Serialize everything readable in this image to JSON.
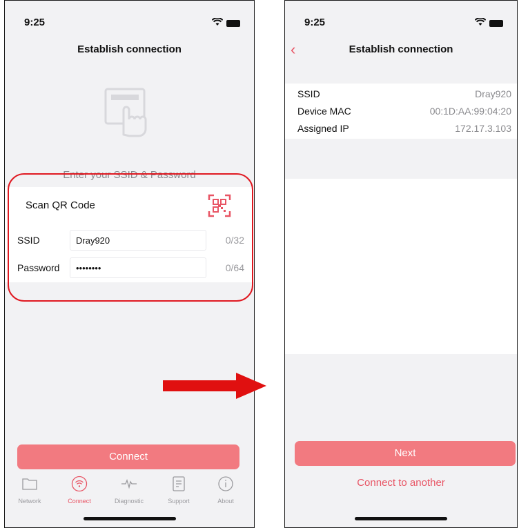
{
  "left": {
    "status_time": "9:25",
    "nav_title": "Establish connection",
    "enter_text": "Enter your SSID & Password",
    "scan_label": "Scan QR Code",
    "ssid_label": "SSID",
    "ssid_value": "Dray920",
    "ssid_count": "0/32",
    "password_label": "Password",
    "password_value": "••••••••",
    "password_count": "0/64",
    "connect_label": "Connect",
    "tabs": [
      {
        "label": "Network",
        "icon": "folder-icon"
      },
      {
        "label": "Connect",
        "icon": "wifi-icon"
      },
      {
        "label": "Diagnostic",
        "icon": "pulse-icon"
      },
      {
        "label": "Support",
        "icon": "document-icon"
      },
      {
        "label": "About",
        "icon": "info-icon"
      }
    ],
    "active_tab": "Connect"
  },
  "right": {
    "status_time": "9:25",
    "nav_title": "Establish connection",
    "info": [
      {
        "key": "SSID",
        "value": "Dray920"
      },
      {
        "key": "Device MAC",
        "value": "00:1D:AA:99:04:20"
      },
      {
        "key": "Assigned IP",
        "value": "172.17.3.103"
      }
    ],
    "next_label": "Next",
    "connect_another_label": "Connect to another"
  },
  "colors": {
    "accent": "#e85464",
    "button": "#f27a80",
    "highlight": "#e01820",
    "arrow": "#e01010"
  }
}
